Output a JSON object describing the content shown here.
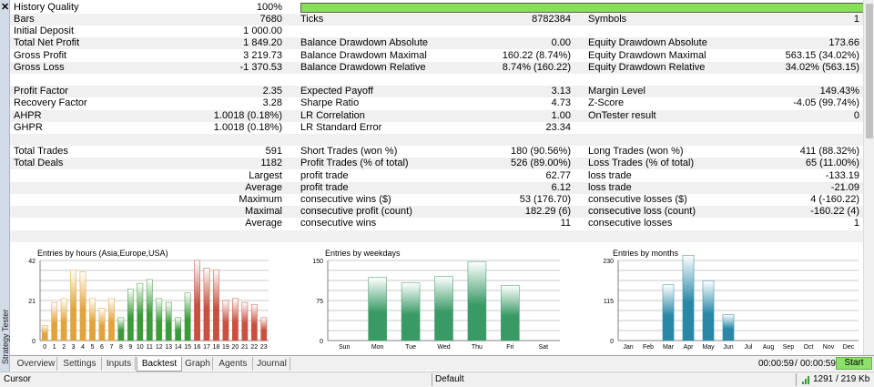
{
  "close_label": "✕",
  "side_label": "Strategy Tester",
  "history": {
    "label": "History Quality",
    "value": "100%",
    "quality_fraction": 1.0,
    "bar_color": "#88e05a"
  },
  "rows": [
    {
      "shade": true,
      "c1": "Bars",
      "v1": "7680",
      "c2": "Ticks",
      "v2": "8782384",
      "c3": "Symbols",
      "v3": "1"
    },
    {
      "shade": false,
      "c1": "Initial Deposit",
      "v1": "1 000.00",
      "c2": "",
      "v2": "",
      "c3": "",
      "v3": ""
    },
    {
      "shade": true,
      "c1": "Total Net Profit",
      "v1": "1 849.20",
      "c2": "Balance Drawdown Absolute",
      "v2": "0.00",
      "c3": "Equity Drawdown Absolute",
      "v3": "173.66"
    },
    {
      "shade": false,
      "c1": "Gross Profit",
      "v1": "3 219.73",
      "c2": "Balance Drawdown Maximal",
      "v2": "160.22 (8.74%)",
      "c3": "Equity Drawdown Maximal",
      "v3": "563.15 (34.02%)"
    },
    {
      "shade": true,
      "c1": "Gross Loss",
      "v1": "-1 370.53",
      "c2": "Balance Drawdown Relative",
      "v2": "8.74% (160.22)",
      "c3": "Equity Drawdown Relative",
      "v3": "34.02% (563.15)"
    },
    {
      "shade": false,
      "c1": "",
      "v1": "",
      "c2": "",
      "v2": "",
      "c3": "",
      "v3": ""
    },
    {
      "shade": true,
      "c1": "Profit Factor",
      "v1": "2.35",
      "c2": "Expected Payoff",
      "v2": "3.13",
      "c3": "Margin Level",
      "v3": "149.43%"
    },
    {
      "shade": false,
      "c1": "Recovery Factor",
      "v1": "3.28",
      "c2": "Sharpe Ratio",
      "v2": "4.73",
      "c3": "Z-Score",
      "v3": "-4.05 (99.74%)"
    },
    {
      "shade": true,
      "c1": "AHPR",
      "v1": "1.0018 (0.18%)",
      "c2": "LR Correlation",
      "v2": "1.00",
      "c3": "OnTester result",
      "v3": "0"
    },
    {
      "shade": false,
      "c1": "GHPR",
      "v1": "1.0018 (0.18%)",
      "c2": "LR Standard Error",
      "v2": "23.34",
      "c3": "",
      "v3": ""
    },
    {
      "shade": true,
      "c1": "",
      "v1": "",
      "c2": "",
      "v2": "",
      "c3": "",
      "v3": ""
    },
    {
      "shade": false,
      "c1": "Total Trades",
      "v1": "591",
      "c2": "Short Trades (won %)",
      "v2": "180 (90.56%)",
      "c3": "Long Trades (won %)",
      "v3": "411 (88.32%)"
    },
    {
      "shade": true,
      "c1": "Total Deals",
      "v1": "1182",
      "c2": "Profit Trades (% of total)",
      "v2": "526 (89.00%)",
      "c3": "Loss Trades (% of total)",
      "v3": "65 (11.00%)"
    },
    {
      "shade": false,
      "r1": "Largest",
      "c2": "profit trade",
      "v2": "62.77",
      "c3": "loss trade",
      "v3": "-133.19"
    },
    {
      "shade": true,
      "r1": "Average",
      "c2": "profit trade",
      "v2": "6.12",
      "c3": "loss trade",
      "v3": "-21.09"
    },
    {
      "shade": false,
      "r1": "Maximum",
      "c2": "consecutive wins ($)",
      "v2": "53 (176.70)",
      "c3": "consecutive losses ($)",
      "v3": "4 (-160.22)"
    },
    {
      "shade": true,
      "r1": "Maximal",
      "c2": "consecutive profit (count)",
      "v2": "182.29 (6)",
      "c3": "consecutive loss (count)",
      "v3": "-160.22 (4)"
    },
    {
      "shade": false,
      "r1": "Average",
      "c2": "consecutive wins",
      "v2": "11",
      "c3": "consecutive losses",
      "v3": "1"
    },
    {
      "shade": true,
      "c1": "",
      "v1": "",
      "c2": "",
      "v2": "",
      "c3": "",
      "v3": ""
    }
  ],
  "chart_data": [
    {
      "type": "bar",
      "title": "Entries by hours (Asia,Europe,USA)",
      "categories": [
        "0",
        "1",
        "2",
        "3",
        "4",
        "5",
        "6",
        "7",
        "8",
        "9",
        "10",
        "11",
        "12",
        "13",
        "14",
        "15",
        "16",
        "17",
        "18",
        "19",
        "20",
        "21",
        "22",
        "23"
      ],
      "values": [
        8,
        20,
        22,
        37,
        36,
        22,
        17,
        22,
        12,
        27,
        30,
        32,
        22,
        20,
        12,
        25,
        42,
        38,
        37,
        21,
        22,
        20,
        19,
        12
      ],
      "yticks": [
        "0",
        "21",
        "42"
      ],
      "ylim": [
        0,
        42
      ],
      "colors": [
        "#e1a43c",
        "#e1a43c",
        "#e1a43c",
        "#e1a43c",
        "#e1a43c",
        "#e1a43c",
        "#e1a43c",
        "#e1a43c",
        "#3d9a3a",
        "#3d9a3a",
        "#3d9a3a",
        "#3d9a3a",
        "#3d9a3a",
        "#3d9a3a",
        "#3d9a3a",
        "#3d9a3a",
        "#c9503f",
        "#c9503f",
        "#c9503f",
        "#c9503f",
        "#c9503f",
        "#c9503f",
        "#c9503f",
        "#c9503f"
      ],
      "grid": true
    },
    {
      "type": "bar",
      "title": "Entries by weekdays",
      "categories": [
        "Sun",
        "Mon",
        "Tue",
        "Wed",
        "Thu",
        "Fri",
        "Sat"
      ],
      "values": [
        0,
        118,
        108,
        120,
        148,
        103,
        0
      ],
      "yticks": [
        "0",
        "75",
        "150"
      ],
      "ylim": [
        0,
        150
      ],
      "colors": [
        "#3a9a66",
        "#3a9a66",
        "#3a9a66",
        "#3a9a66",
        "#3a9a66",
        "#3a9a66",
        "#3a9a66"
      ],
      "grid": true
    },
    {
      "type": "bar",
      "title": "Entries by months",
      "categories": [
        "Jan",
        "Feb",
        "Mar",
        "Apr",
        "May",
        "Jun",
        "Jul",
        "Aug",
        "Sep",
        "Oct",
        "Nov",
        "Dec"
      ],
      "values": [
        0,
        0,
        160,
        245,
        172,
        75,
        0,
        0,
        0,
        0,
        0,
        0
      ],
      "yticks": [
        "0",
        "115",
        "230"
      ],
      "ylim": [
        0,
        230
      ],
      "colors": [
        "#2a88a6",
        "#2a88a6",
        "#2a88a6",
        "#2a88a6",
        "#2a88a6",
        "#2a88a6",
        "#2a88a6",
        "#2a88a6",
        "#2a88a6",
        "#2a88a6",
        "#2a88a6",
        "#2a88a6"
      ],
      "grid": true
    }
  ],
  "tabs": [
    {
      "label": "Overview",
      "active": false
    },
    {
      "label": "Settings",
      "active": false
    },
    {
      "label": "Inputs",
      "active": false
    },
    {
      "label": "Backtest",
      "active": true
    },
    {
      "label": "Graph",
      "active": false
    },
    {
      "label": "Agents",
      "active": false
    },
    {
      "label": "Journal",
      "active": false
    }
  ],
  "timers": {
    "elapsed": "00:00:59",
    "total": "00:00:59"
  },
  "start_label": "Start",
  "status": {
    "left": "Cursor",
    "middle": "Default",
    "traffic": "1291 / 219 Kb"
  }
}
